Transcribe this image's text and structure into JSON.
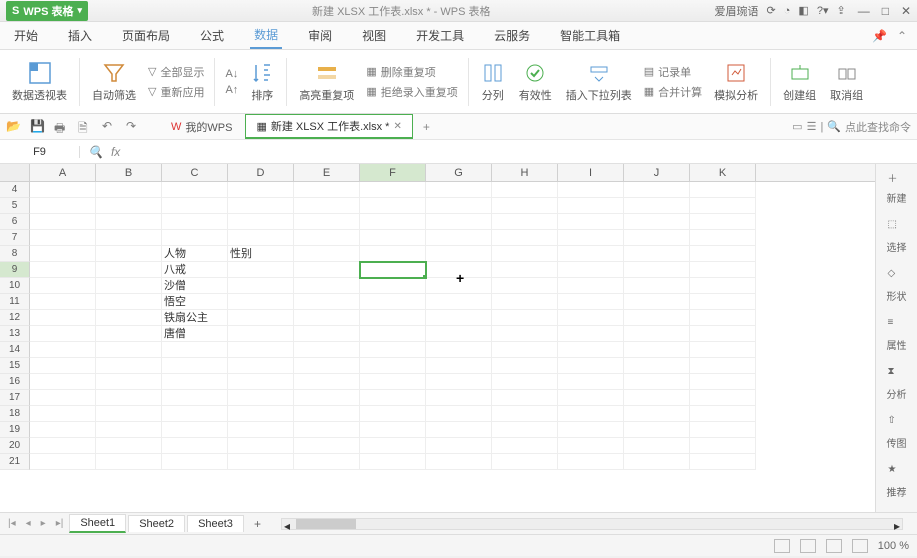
{
  "app": {
    "name": "WPS 表格",
    "doc_title": "新建 XLSX 工作表.xlsx * - WPS 表格",
    "user": "爱眉琬语"
  },
  "menu": {
    "tabs": [
      "开始",
      "插入",
      "页面布局",
      "公式",
      "数据",
      "审阅",
      "视图",
      "开发工具",
      "云服务",
      "智能工具箱"
    ],
    "active_index": 4
  },
  "ribbon": {
    "pivot": "数据透视表",
    "autofilter": "自动筛选",
    "show_all": "全部显示",
    "reapply": "重新应用",
    "sort": "排序",
    "highlight_dup": "高亮重复项",
    "delete_dup": "删除重复项",
    "reject_dup": "拒绝录入重复项",
    "text_to_cols": "分列",
    "validation": "有效性",
    "dropdown": "插入下拉列表",
    "record_form": "记录单",
    "consolidate": "合并计算",
    "scenario": "模拟分析",
    "group": "创建组",
    "ungroup": "取消组"
  },
  "qat": {
    "wps_tab": "我的WPS",
    "doc_tab": "新建 XLSX 工作表.xlsx *",
    "search_prompt": "点此查找命令"
  },
  "formula": {
    "namebox": "F9",
    "fx": "fx",
    "value": ""
  },
  "grid": {
    "cols": [
      "A",
      "B",
      "C",
      "D",
      "E",
      "F",
      "G",
      "H",
      "I",
      "J",
      "K"
    ],
    "row_start": 4,
    "row_end": 21,
    "active_col": "F",
    "active_row": 9,
    "cells": {
      "C8": "人物",
      "D8": "性别",
      "C9": "八戒",
      "C10": "沙僧",
      "C11": "悟空",
      "C12": "铁扇公主",
      "C13": "唐僧"
    }
  },
  "sidepanel": [
    "新建",
    "选择",
    "形状",
    "属性",
    "分析",
    "传图",
    "推荐"
  ],
  "sheets": {
    "tabs": [
      "Sheet1",
      "Sheet2",
      "Sheet3"
    ],
    "active_index": 0
  },
  "status": {
    "zoom": "100 %"
  }
}
